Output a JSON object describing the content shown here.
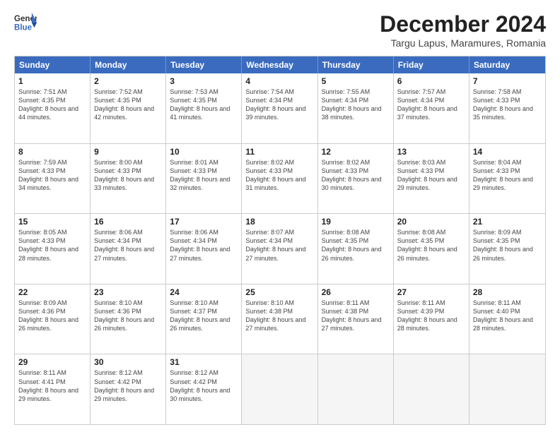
{
  "header": {
    "logo_line1": "General",
    "logo_line2": "Blue",
    "title": "December 2024",
    "subtitle": "Targu Lapus, Maramures, Romania"
  },
  "day_names": [
    "Sunday",
    "Monday",
    "Tuesday",
    "Wednesday",
    "Thursday",
    "Friday",
    "Saturday"
  ],
  "weeks": [
    [
      {
        "num": "1",
        "sunrise": "7:51 AM",
        "sunset": "4:35 PM",
        "daylight": "8 hours and 44 minutes."
      },
      {
        "num": "2",
        "sunrise": "7:52 AM",
        "sunset": "4:35 PM",
        "daylight": "8 hours and 42 minutes."
      },
      {
        "num": "3",
        "sunrise": "7:53 AM",
        "sunset": "4:35 PM",
        "daylight": "8 hours and 41 minutes."
      },
      {
        "num": "4",
        "sunrise": "7:54 AM",
        "sunset": "4:34 PM",
        "daylight": "8 hours and 39 minutes."
      },
      {
        "num": "5",
        "sunrise": "7:55 AM",
        "sunset": "4:34 PM",
        "daylight": "8 hours and 38 minutes."
      },
      {
        "num": "6",
        "sunrise": "7:57 AM",
        "sunset": "4:34 PM",
        "daylight": "8 hours and 37 minutes."
      },
      {
        "num": "7",
        "sunrise": "7:58 AM",
        "sunset": "4:33 PM",
        "daylight": "8 hours and 35 minutes."
      }
    ],
    [
      {
        "num": "8",
        "sunrise": "7:59 AM",
        "sunset": "4:33 PM",
        "daylight": "8 hours and 34 minutes."
      },
      {
        "num": "9",
        "sunrise": "8:00 AM",
        "sunset": "4:33 PM",
        "daylight": "8 hours and 33 minutes."
      },
      {
        "num": "10",
        "sunrise": "8:01 AM",
        "sunset": "4:33 PM",
        "daylight": "8 hours and 32 minutes."
      },
      {
        "num": "11",
        "sunrise": "8:02 AM",
        "sunset": "4:33 PM",
        "daylight": "8 hours and 31 minutes."
      },
      {
        "num": "12",
        "sunrise": "8:02 AM",
        "sunset": "4:33 PM",
        "daylight": "8 hours and 30 minutes."
      },
      {
        "num": "13",
        "sunrise": "8:03 AM",
        "sunset": "4:33 PM",
        "daylight": "8 hours and 29 minutes."
      },
      {
        "num": "14",
        "sunrise": "8:04 AM",
        "sunset": "4:33 PM",
        "daylight": "8 hours and 29 minutes."
      }
    ],
    [
      {
        "num": "15",
        "sunrise": "8:05 AM",
        "sunset": "4:33 PM",
        "daylight": "8 hours and 28 minutes."
      },
      {
        "num": "16",
        "sunrise": "8:06 AM",
        "sunset": "4:34 PM",
        "daylight": "8 hours and 27 minutes."
      },
      {
        "num": "17",
        "sunrise": "8:06 AM",
        "sunset": "4:34 PM",
        "daylight": "8 hours and 27 minutes."
      },
      {
        "num": "18",
        "sunrise": "8:07 AM",
        "sunset": "4:34 PM",
        "daylight": "8 hours and 27 minutes."
      },
      {
        "num": "19",
        "sunrise": "8:08 AM",
        "sunset": "4:35 PM",
        "daylight": "8 hours and 26 minutes."
      },
      {
        "num": "20",
        "sunrise": "8:08 AM",
        "sunset": "4:35 PM",
        "daylight": "8 hours and 26 minutes."
      },
      {
        "num": "21",
        "sunrise": "8:09 AM",
        "sunset": "4:35 PM",
        "daylight": "8 hours and 26 minutes."
      }
    ],
    [
      {
        "num": "22",
        "sunrise": "8:09 AM",
        "sunset": "4:36 PM",
        "daylight": "8 hours and 26 minutes."
      },
      {
        "num": "23",
        "sunrise": "8:10 AM",
        "sunset": "4:36 PM",
        "daylight": "8 hours and 26 minutes."
      },
      {
        "num": "24",
        "sunrise": "8:10 AM",
        "sunset": "4:37 PM",
        "daylight": "8 hours and 26 minutes."
      },
      {
        "num": "25",
        "sunrise": "8:10 AM",
        "sunset": "4:38 PM",
        "daylight": "8 hours and 27 minutes."
      },
      {
        "num": "26",
        "sunrise": "8:11 AM",
        "sunset": "4:38 PM",
        "daylight": "8 hours and 27 minutes."
      },
      {
        "num": "27",
        "sunrise": "8:11 AM",
        "sunset": "4:39 PM",
        "daylight": "8 hours and 28 minutes."
      },
      {
        "num": "28",
        "sunrise": "8:11 AM",
        "sunset": "4:40 PM",
        "daylight": "8 hours and 28 minutes."
      }
    ],
    [
      {
        "num": "29",
        "sunrise": "8:11 AM",
        "sunset": "4:41 PM",
        "daylight": "8 hours and 29 minutes."
      },
      {
        "num": "30",
        "sunrise": "8:12 AM",
        "sunset": "4:42 PM",
        "daylight": "8 hours and 29 minutes."
      },
      {
        "num": "31",
        "sunrise": "8:12 AM",
        "sunset": "4:42 PM",
        "daylight": "8 hours and 30 minutes."
      },
      null,
      null,
      null,
      null
    ]
  ]
}
